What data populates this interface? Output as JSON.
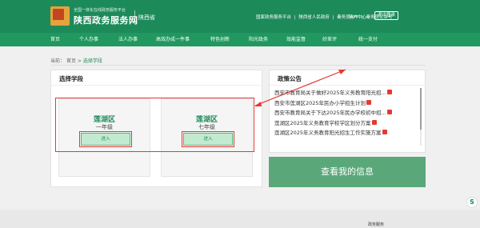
{
  "header": {
    "platform_subtitle": "全国一体化在线政务服务平台",
    "site_title": "陕西政务服务网",
    "region": "陕西省",
    "top_links": [
      "国家政务服务平台",
      "|",
      "陕西省人民政府",
      "|",
      "秦务员APP",
      "|",
      "秦务员公众号"
    ],
    "user_center": "用户中心",
    "logout": "退出登录"
  },
  "nav": {
    "items": [
      {
        "label": "首页"
      },
      {
        "label": "个人办事"
      },
      {
        "label": "法人办事"
      },
      {
        "label": "高效办成一件事"
      },
      {
        "label": "特色创新"
      },
      {
        "label": "阳光政务"
      },
      {
        "label": "效能监督"
      },
      {
        "label": "好差评"
      },
      {
        "label": "统一支付"
      }
    ]
  },
  "breadcrumb": {
    "prefix": "当前：",
    "home": "首页",
    "sep": ">",
    "current": "选择学段"
  },
  "school_panel": {
    "title": "选择学段",
    "cards": [
      {
        "district": "莲湖区",
        "grade": "一年级",
        "button": "进入"
      },
      {
        "district": "莲湖区",
        "grade": "七年级",
        "button": "进入"
      }
    ]
  },
  "policy_panel": {
    "title": "政策公告",
    "items": [
      {
        "text": "西安市教育局关于做好2025年义务教育阳光招..."
      },
      {
        "text": "西安市莲湖区2025年民办小学招生计划"
      },
      {
        "text": "西安市教育局关于下达2025年民办学校初中招..."
      },
      {
        "text": "莲湖区2025年义务教育学校学区划分方案"
      },
      {
        "text": "莲湖区2025年义务教育阳光招生工作实施方案"
      }
    ]
  },
  "view_info_button": "查看我的信息",
  "footer": {
    "text": "政务服务"
  },
  "colors": {
    "header_green": "#1d8a5a",
    "nav_green": "#20985f",
    "button_green": "#5aa87a",
    "highlight_red": "#e53935"
  },
  "icons": {
    "logo": "logo-icon",
    "new_badge": "new-badge-icon",
    "float": "assistant-float-icon"
  }
}
